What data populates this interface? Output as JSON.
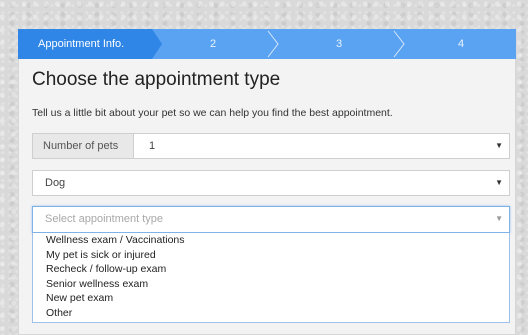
{
  "steps": [
    {
      "label": "Appointment Info."
    },
    {
      "label": "2"
    },
    {
      "label": "3"
    },
    {
      "label": "4"
    }
  ],
  "heading": "Choose the appointment type",
  "intro": "Tell us a little bit about your pet so we can help you find the best appointment.",
  "pets": {
    "addon_label": "Number of pets",
    "value": "1"
  },
  "species": {
    "value": "Dog"
  },
  "appointment_type": {
    "placeholder": "Select appointment type",
    "options": [
      "Wellness exam / Vaccinations",
      "My pet is sick or injured",
      "Recheck / follow-up exam",
      "Senior wellness exam",
      "New pet exam",
      "Other"
    ]
  },
  "icons": {
    "caret": "caret-down-icon",
    "step_separator": "chevron-right-icon"
  },
  "colors": {
    "step_active": "#2f86e6",
    "step_bar": "#5aa3f2",
    "focus_border": "#7fb2e6"
  }
}
